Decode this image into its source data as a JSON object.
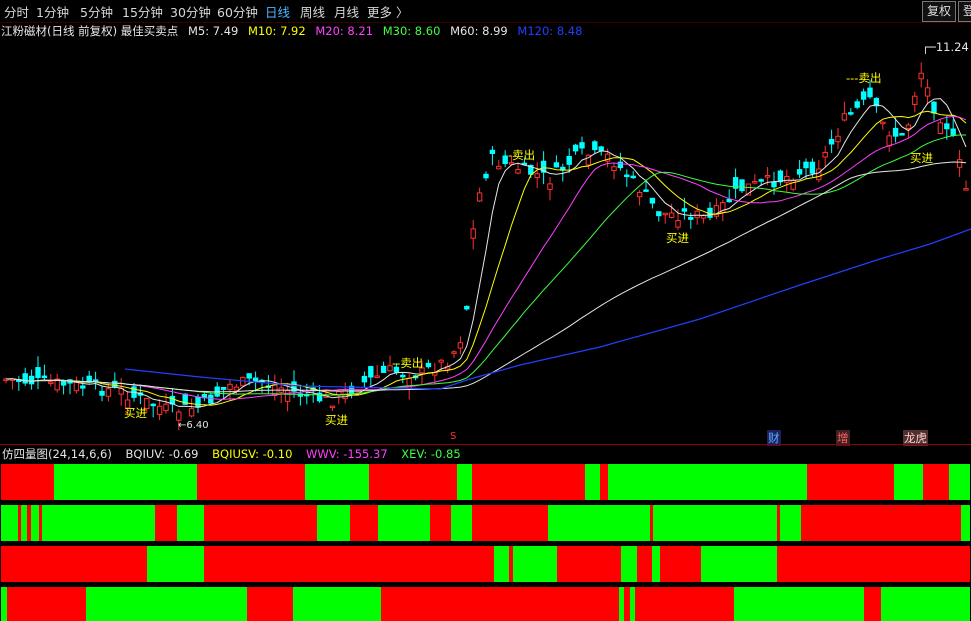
{
  "tabs": [
    {
      "label": "分时",
      "active": false
    },
    {
      "label": "1分钟",
      "active": false
    },
    {
      "label": "5分钟",
      "active": false
    },
    {
      "label": "15分钟",
      "active": false
    },
    {
      "label": "30分钟",
      "active": false
    },
    {
      "label": "60分钟",
      "active": false
    },
    {
      "label": "日线",
      "active": true
    },
    {
      "label": "周线",
      "active": false
    },
    {
      "label": "月线",
      "active": false
    },
    {
      "label": "更多 〉",
      "active": false
    }
  ],
  "toolbar": {
    "restore_label": "复权",
    "login_label": "登"
  },
  "header": {
    "stock_title": "江粉磁材(日线 前复权) 最佳买卖点",
    "ma": [
      {
        "label": "M5: 7.49",
        "color": "#e6e6e6"
      },
      {
        "label": "M10: 7.92",
        "color": "#ffff00"
      },
      {
        "label": "M20: 8.21",
        "color": "#ff40ff"
      },
      {
        "label": "M30: 8.60",
        "color": "#40ff40"
      },
      {
        "label": "M60: 8.99",
        "color": "#e6e6e6"
      },
      {
        "label": "M120: 8.48",
        "color": "#2040ff"
      }
    ]
  },
  "chart_labels": {
    "sell": "卖出",
    "buy": "买进",
    "high_price": "11.24",
    "low_price": "6.40",
    "events": [
      "财",
      "增",
      "龙虎"
    ],
    "s_mark": "S"
  },
  "indicator": {
    "title": "仿四量图(24,14,6,6)",
    "values": [
      {
        "label": "BQIUV: -0.69",
        "color": "#e6e6e6"
      },
      {
        "label": "BQIUSV: -0.10",
        "color": "#ffff00"
      },
      {
        "label": "WWV: -155.37",
        "color": "#ff40ff"
      },
      {
        "label": "XEV: -0.85",
        "color": "#40ff40"
      }
    ],
    "colors": {
      "up": "#00ff00",
      "down": "#ff0000"
    }
  }
}
